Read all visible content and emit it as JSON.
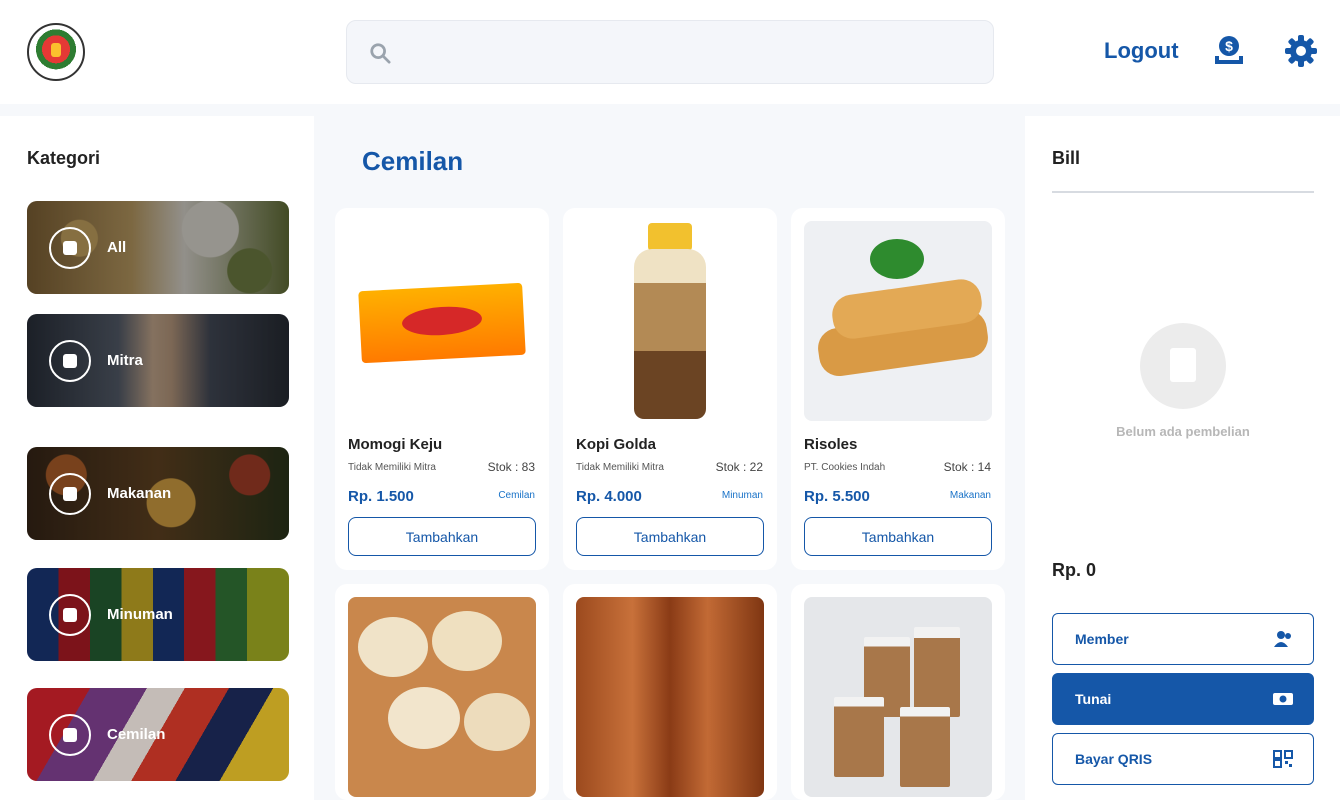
{
  "header": {
    "search_placeholder": "",
    "logout_label": "Logout"
  },
  "left": {
    "title": "Kategori",
    "categories": [
      {
        "label": "All"
      },
      {
        "label": "Mitra"
      },
      {
        "label": "Makanan"
      },
      {
        "label": "Minuman"
      },
      {
        "label": "Cemilan"
      }
    ]
  },
  "main": {
    "title": "Cemilan",
    "products": [
      {
        "name": "Momogi Keju",
        "seller": "Tidak Memiliki Mitra",
        "stock": "Stok : 83",
        "price": "Rp. 1.500",
        "category": "Cemilan",
        "button": "Tambahkan"
      },
      {
        "name": "Kopi Golda",
        "seller": "Tidak Memiliki Mitra",
        "stock": "Stok : 22",
        "price": "Rp. 4.000",
        "category": "Minuman",
        "button": "Tambahkan"
      },
      {
        "name": "Risoles",
        "seller": "PT. Cookies Indah",
        "stock": "Stok : 14",
        "price": "Rp. 5.500",
        "category": "Makanan",
        "button": "Tambahkan"
      }
    ]
  },
  "bill": {
    "title": "Bill",
    "empty_text": "Belum ada pembelian",
    "total": "Rp. 0",
    "payments": [
      {
        "label": "Member"
      },
      {
        "label": "Tunai"
      },
      {
        "label": "Bayar QRIS"
      }
    ]
  },
  "colors": {
    "accent": "#1557a8",
    "background": "#f6f8fb"
  }
}
